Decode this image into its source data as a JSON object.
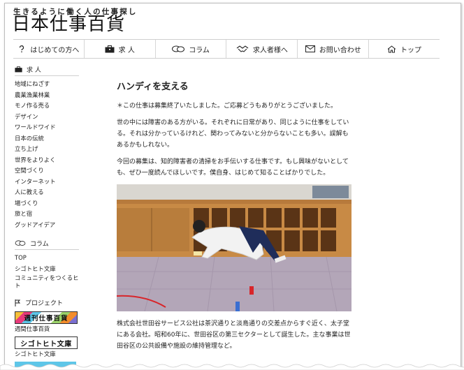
{
  "site": {
    "tagline": "生きるように働く人の仕事探し",
    "logo": "日本仕事百貨"
  },
  "nav": [
    {
      "label": "はじめての方へ",
      "icon": "question-icon"
    },
    {
      "label": "求 人",
      "icon": "briefcase-icon"
    },
    {
      "label": "コラム",
      "icon": "speech-bubble-icon"
    },
    {
      "label": "求人者様へ",
      "icon": "handshake-icon"
    },
    {
      "label": "お問い合わせ",
      "icon": "envelope-icon"
    },
    {
      "label": "トップ",
      "icon": "home-icon"
    }
  ],
  "sidebar": {
    "jobs_heading": "求 人",
    "jobs": [
      "地域にねざす",
      "農業漁業林業",
      "モノ作る売る",
      "デザイン",
      "ワールドワイド",
      "日本の伝統",
      "立ち上げ",
      "世界をよりよく",
      "空間づくり",
      "インターネット",
      "人に教える",
      "場づくり",
      "旅と宿",
      "グッドアイデア"
    ],
    "columns_heading": "コラム",
    "columns": [
      "TOP",
      "シゴトヒト文庫",
      "コミュニティをつくるヒト"
    ],
    "projects_heading": "プロジェクト",
    "banner1": "週刊仕事百貨",
    "banner1_caption": "週間仕事百貨",
    "banner2": "シゴトヒト文庫",
    "banner2_caption": "シゴトヒト文庫"
  },
  "article": {
    "title": "ハンディを支える",
    "paragraphs": [
      "＊この仕事は募集終了いたしました。ご応募どうもありがとうございました。",
      "世の中には障害のある方がいる。それぞれに日常があり、同じように仕事をしている。それは分かっているけれど、関わってみないと分からないことも多い。誤解もあるかもしれない。",
      "今回の募集は、知的障害者の清掃をお手伝いする仕事です。もし興味がないとしても、ぜひ一度読んでほしいです。僕自身、はじめて知ることばかりでした。"
    ],
    "after_photo": "株式会社世田谷サービス公社は茶沢通りと淡島通りの交差点からすぐ近く、太子堂にある会社。昭和60年に、世田谷区の第三セクターとして誕生した。主な事業は世田谷区の公共設備や施設の維持管理など。"
  }
}
